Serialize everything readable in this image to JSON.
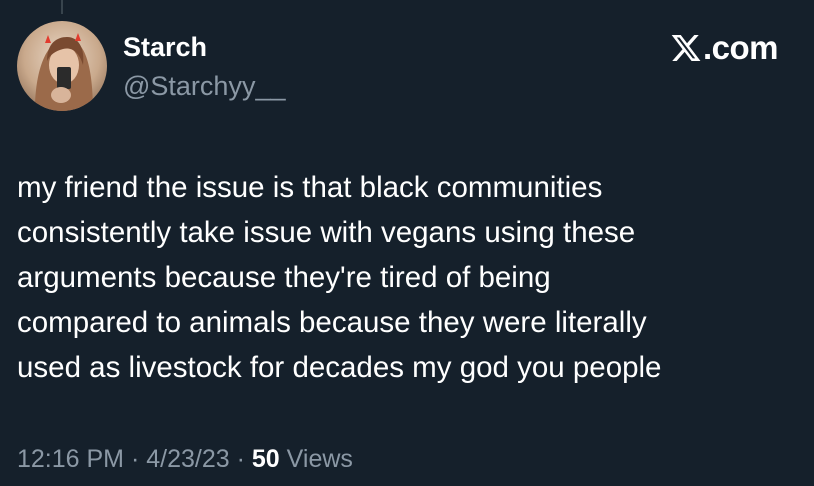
{
  "author": {
    "display_name": "Starch",
    "handle": "@Starchyy__",
    "avatar_icon": "user-avatar-photo"
  },
  "brand": {
    "text": ".com",
    "logo_icon": "x-logo-icon"
  },
  "tweet": {
    "lines": [
      "my friend the issue is that black communities",
      "consistently take issue with vegans using these",
      "arguments because they're tired of being",
      "compared to animals because they were literally",
      "used as livestock for decades my god you people"
    ]
  },
  "meta": {
    "time": "12:16 PM",
    "separator": "·",
    "date": "4/23/23",
    "views_count": "50",
    "views_label": "Views"
  },
  "colors": {
    "background": "#15202b",
    "text_primary": "#ffffff",
    "text_secondary": "#8b98a5"
  }
}
